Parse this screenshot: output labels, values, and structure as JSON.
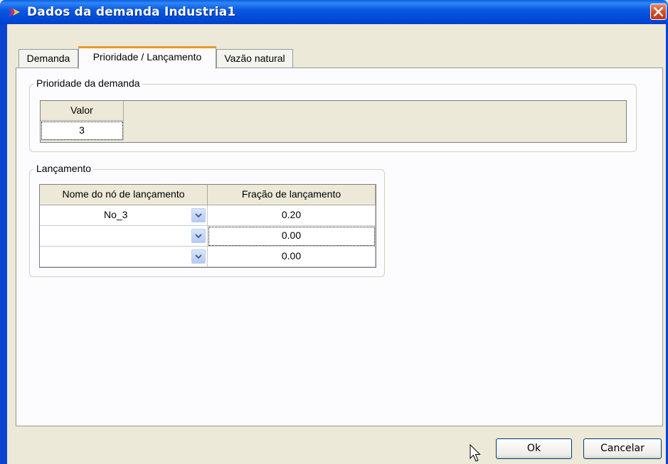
{
  "window": {
    "title": "Dados da demanda Industria1"
  },
  "tabs": [
    {
      "label": "Demanda",
      "active": false
    },
    {
      "label": "Prioridade / Lançamento",
      "active": true
    },
    {
      "label": "Vazão natural",
      "active": false
    }
  ],
  "priority": {
    "group_label": "Prioridade da demanda",
    "header": "Valor",
    "value": "3"
  },
  "release": {
    "group_label": "Lançamento",
    "headers": [
      "Nome do nó de lançamento",
      "Fração de lançamento"
    ],
    "rows": [
      {
        "node": "No_3",
        "fraction": "0.20"
      },
      {
        "node": "",
        "fraction": "0.00"
      },
      {
        "node": "",
        "fraction": "0.00"
      }
    ]
  },
  "buttons": {
    "ok": "Ok",
    "cancel": "Cancelar"
  },
  "colors": {
    "titlebar": "#0054e3",
    "active_tab_accent": "#e79a2a",
    "close_button": "#d2451f"
  },
  "icons": [
    "app-arrow-icon",
    "close-icon",
    "chevron-down-icon",
    "mouse-cursor-icon"
  ]
}
